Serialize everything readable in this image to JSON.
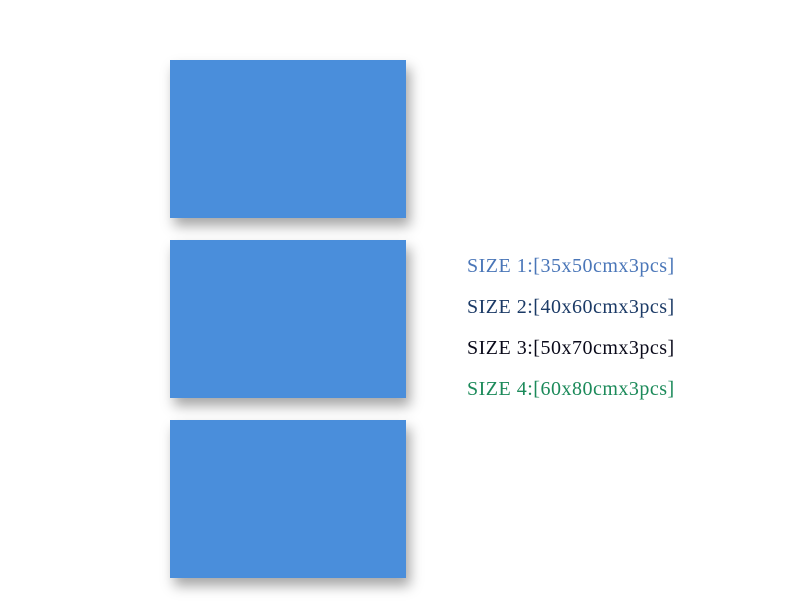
{
  "panels": {
    "count": 3,
    "color": "#4a8edb"
  },
  "sizes": [
    {
      "label": "SIZE 1:",
      "value": "[35x50cmx3pcs]",
      "colorClass": "color-1"
    },
    {
      "label": "SIZE 2:",
      "value": "[40x60cmx3pcs]",
      "colorClass": "color-2"
    },
    {
      "label": "SIZE 3:",
      "value": "[50x70cmx3pcs]",
      "colorClass": "color-3"
    },
    {
      "label": "SIZE 4:",
      "value": "[60x80cmx3pcs]",
      "colorClass": "color-4"
    }
  ]
}
